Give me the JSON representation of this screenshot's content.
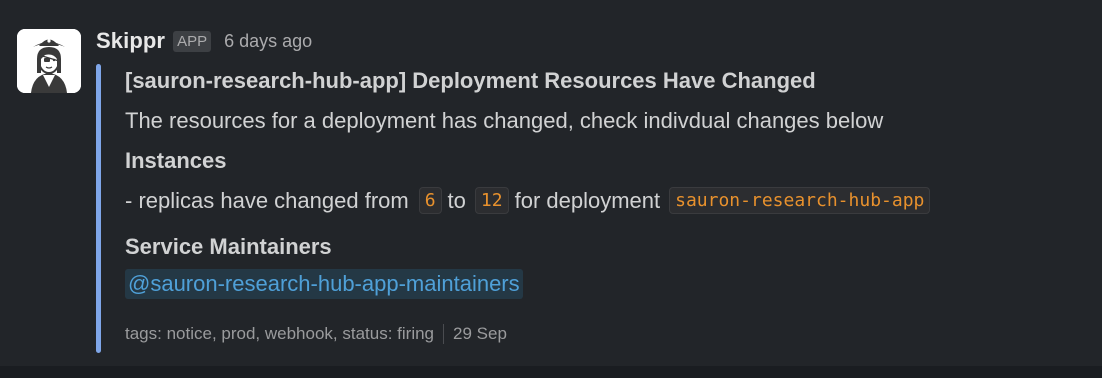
{
  "message": {
    "sender": "Skippr",
    "badge": "APP",
    "time": "6 days ago",
    "avatar_icon": "pirate-avatar-icon",
    "accent_color": "#7fa6e8"
  },
  "attachment": {
    "title": "[sauron-research-hub-app] Deployment Resources Have Changed",
    "description": "The resources for a deployment has changed, check indivdual changes below",
    "section_heading": "Instances",
    "replicas": {
      "prefix": "- replicas have changed from",
      "from": "6",
      "middle": "to",
      "to": "12",
      "suffix": "for deployment",
      "deployment": "sauron-research-hub-app"
    },
    "maintainers_heading": "Service Maintainers",
    "maintainers_mention": "@sauron-research-hub-app-maintainers",
    "footer": {
      "tags": "tags: notice, prod, webhook, status: firing",
      "date": "29 Sep"
    }
  }
}
